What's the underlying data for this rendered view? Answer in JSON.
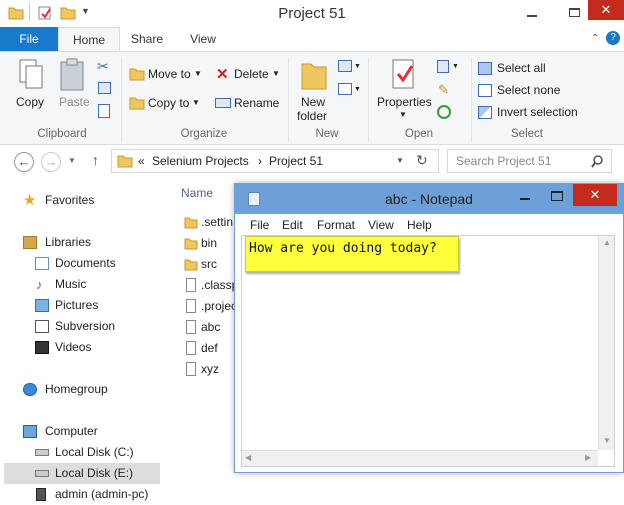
{
  "window": {
    "title": "Project 51"
  },
  "ribbon_tabs": [
    "File",
    "Home",
    "Share",
    "View"
  ],
  "clipboard": {
    "copy": "Copy",
    "paste": "Paste",
    "group": "Clipboard"
  },
  "organize": {
    "move_to": "Move to",
    "copy_to": "Copy to",
    "delete": "Delete",
    "rename": "Rename",
    "group": "Organize"
  },
  "new": {
    "new_folder_line1": "New",
    "new_folder_line2": "folder",
    "group": "New"
  },
  "open": {
    "properties": "Properties",
    "group": "Open"
  },
  "select": {
    "select_all": "Select all",
    "select_none": "Select none",
    "invert": "Invert selection",
    "group": "Select"
  },
  "address": {
    "crumb_prefix": "«",
    "crumb1": "Selenium Projects",
    "crumb_sep": "›",
    "crumb2": "Project 51"
  },
  "search": {
    "placeholder": "Search Project 51"
  },
  "nav": {
    "favorites": "Favorites",
    "libraries": "Libraries",
    "documents": "Documents",
    "music": "Music",
    "pictures": "Pictures",
    "subversion": "Subversion",
    "videos": "Videos",
    "homegroup": "Homegroup",
    "computer": "Computer",
    "local_c": "Local Disk (C:)",
    "local_e": "Local Disk (E:)",
    "admin": "admin (admin-pc)"
  },
  "files": {
    "header": "Name",
    "items": [
      ".settin",
      "bin",
      "src",
      ".classp",
      ".projec",
      "abc",
      "def",
      "xyz"
    ]
  },
  "notepad": {
    "title": "abc - Notepad",
    "menu": [
      "File",
      "Edit",
      "Format",
      "View",
      "Help"
    ],
    "text": "How are you doing today?"
  },
  "colors": {
    "file_tab": "#1979ca",
    "close": "#c42b1c",
    "notepad_title": "#6ea0d8",
    "highlight": "#ffff3c"
  }
}
